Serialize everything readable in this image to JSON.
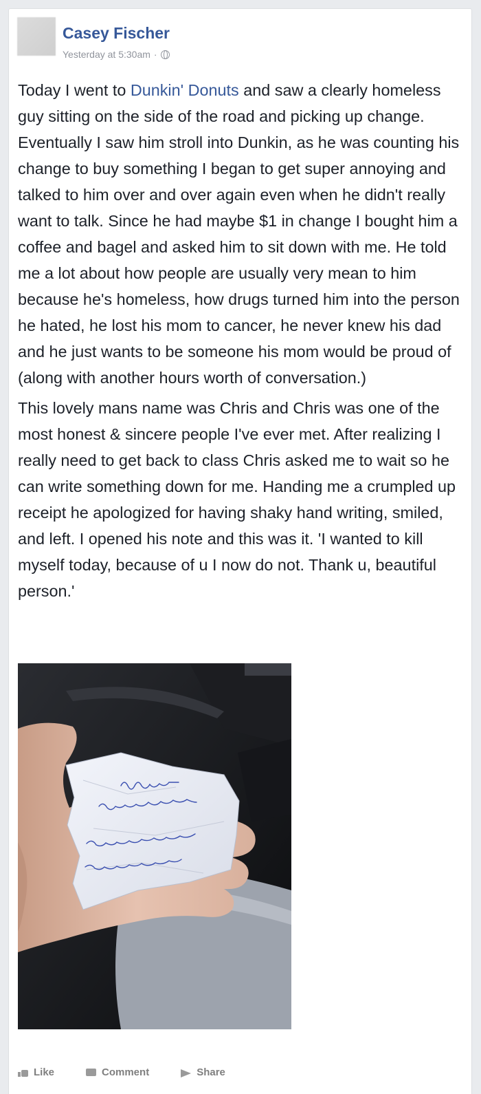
{
  "post": {
    "author": "Casey Fischer",
    "timestamp": "Yesterday at 5:30am",
    "separator": "·",
    "paragraph1": {
      "before_link": "Today I went to ",
      "link": "Dunkin' Donuts",
      "after_link": " and saw a clearly homeless guy sitting on the side of the road and picking up change. Eventually I saw him stroll into Dunkin, as he was counting his change to buy something I began to get super annoying and talked to him over and over again even when he didn't really want to talk. Since he had maybe $1 in change I bought him a coffee and bagel and asked him to sit down with me. He told me a lot about how people are usually very mean to him because he's homeless, how drugs turned him into the person he hated, he lost his mom to cancer, he never knew his dad and he just wants to be someone his mom would be proud of (along with another hours worth of conversation.)"
    },
    "paragraph2": "This lovely mans name was Chris and Chris was one of the most honest & sincere people I've ever met. After realizing I really need to get back to class Chris asked me to wait so he can write something down for me. Handing me a crumpled up receipt he apologized for having shaky hand writing, smiled, and left. I opened his note and this was it. 'I wanted to kill myself today, because of u I now do not. Thank u, beautiful person.'",
    "photo_note_lines": [
      "I wanted to",
      "Kill myself today",
      "Because of u I now do not",
      "thank u beautiful person"
    ]
  },
  "actions": {
    "like": "Like",
    "comment": "Comment",
    "share": "Share"
  },
  "colors": {
    "link": "#365899",
    "background": "#e9ebee",
    "ink": "#3a4fb0"
  },
  "icons": [
    "globe-icon",
    "thumb-icon",
    "comment-icon",
    "share-icon"
  ]
}
